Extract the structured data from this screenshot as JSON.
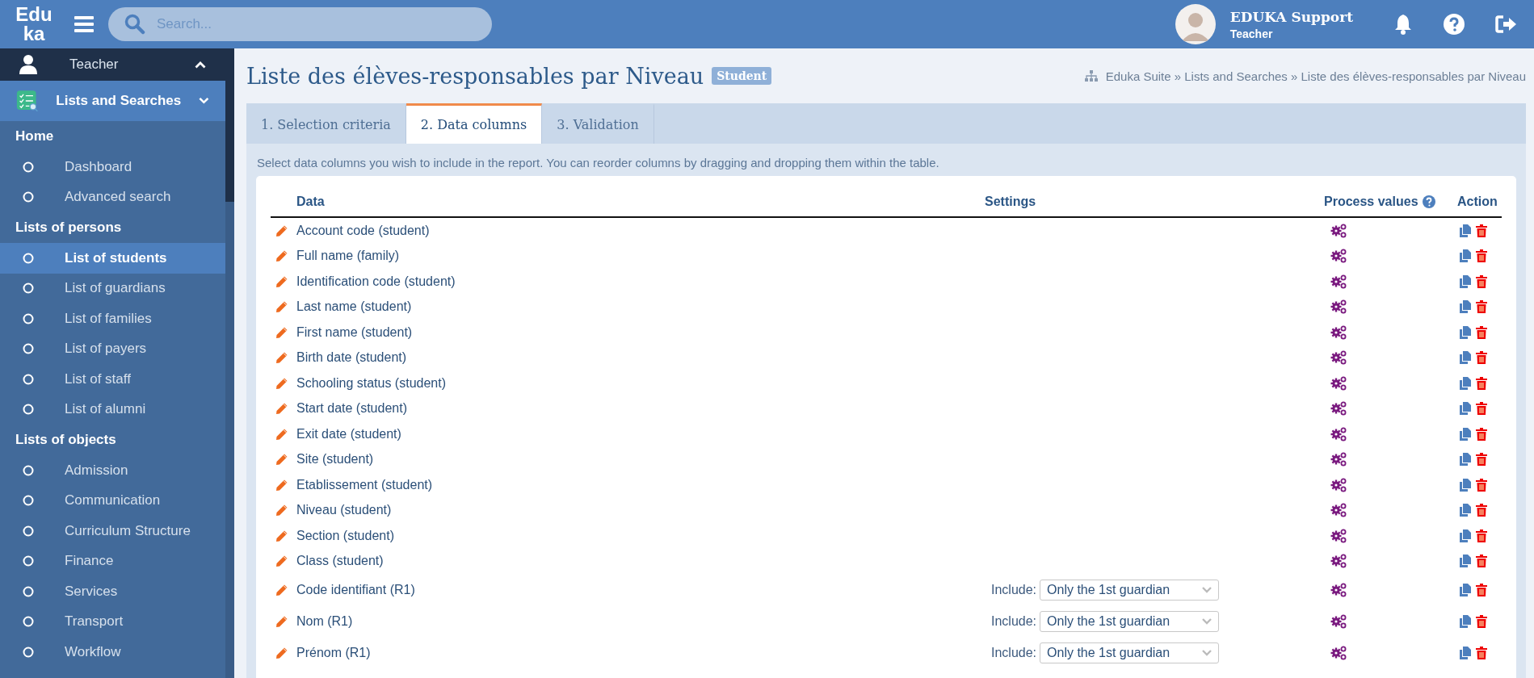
{
  "header": {
    "logo": [
      "Edu",
      "ka"
    ],
    "search": {
      "placeholder": "Search..."
    },
    "user": {
      "name": "EDUKA Support",
      "role": "Teacher"
    }
  },
  "sidebar": {
    "user_row": {
      "label": "Teacher"
    },
    "module": {
      "label": "Lists and Searches"
    },
    "sections": [
      {
        "title": "Home",
        "items": [
          {
            "label": "Dashboard",
            "selected": false
          },
          {
            "label": "Advanced search",
            "selected": false
          }
        ]
      },
      {
        "title": "Lists of persons",
        "items": [
          {
            "label": "List of students",
            "selected": true
          },
          {
            "label": "List of guardians",
            "selected": false
          },
          {
            "label": "List of families",
            "selected": false
          },
          {
            "label": "List of payers",
            "selected": false
          },
          {
            "label": "List of staff",
            "selected": false
          },
          {
            "label": "List of alumni",
            "selected": false
          }
        ]
      },
      {
        "title": "Lists of objects",
        "items": [
          {
            "label": "Admission",
            "selected": false
          },
          {
            "label": "Communication",
            "selected": false
          },
          {
            "label": "Curriculum Structure",
            "selected": false
          },
          {
            "label": "Finance",
            "selected": false
          },
          {
            "label": "Services",
            "selected": false
          },
          {
            "label": "Transport",
            "selected": false
          },
          {
            "label": "Workflow",
            "selected": false
          }
        ]
      }
    ]
  },
  "page": {
    "title": "Liste des élèves-responsables par Niveau",
    "badge": "Student",
    "breadcrumb": "Eduka Suite » Lists and Searches » Liste des élèves-responsables par Niveau"
  },
  "tabs": [
    {
      "label": "1. Selection criteria",
      "selected": false
    },
    {
      "label": "2. Data columns",
      "selected": true
    },
    {
      "label": "3. Validation",
      "selected": false
    }
  ],
  "instructions": "Select data columns you wish to include in the report. You can reorder columns by dragging and dropping them within the table.",
  "table": {
    "columns": [
      "Data",
      "Settings",
      "Process values",
      "Action"
    ],
    "rows": [
      {
        "kind": "plain",
        "data": "Account code (student)"
      },
      {
        "kind": "plain",
        "data": "Full name (family)"
      },
      {
        "kind": "plain",
        "data": "Identification code (student)"
      },
      {
        "kind": "plain",
        "data": "Last name (student)"
      },
      {
        "kind": "plain",
        "data": "First name (student)"
      },
      {
        "kind": "plain",
        "data": "Birth date (student)"
      },
      {
        "kind": "plain",
        "data": "Schooling status (student)"
      },
      {
        "kind": "plain",
        "data": "Start date (student)"
      },
      {
        "kind": "plain",
        "data": "Exit date (student)"
      },
      {
        "kind": "plain",
        "data": "Site (student)"
      },
      {
        "kind": "plain",
        "data": "Etablissement (student)"
      },
      {
        "kind": "plain",
        "data": "Niveau (student)"
      },
      {
        "kind": "plain",
        "data": "Section (student)"
      },
      {
        "kind": "plain",
        "data": "Class (student)"
      },
      {
        "kind": "select",
        "data": "Code identifiant (R1)",
        "setting_label": "Include:",
        "setting_value": "Only the 1st guardian"
      },
      {
        "kind": "select",
        "data": "Nom (R1)",
        "setting_label": "Include:",
        "setting_value": "Only the 1st guardian"
      },
      {
        "kind": "select",
        "data": "Prénom (R1)",
        "setting_label": "Include:",
        "setting_value": "Only the 1st guardian"
      }
    ]
  }
}
